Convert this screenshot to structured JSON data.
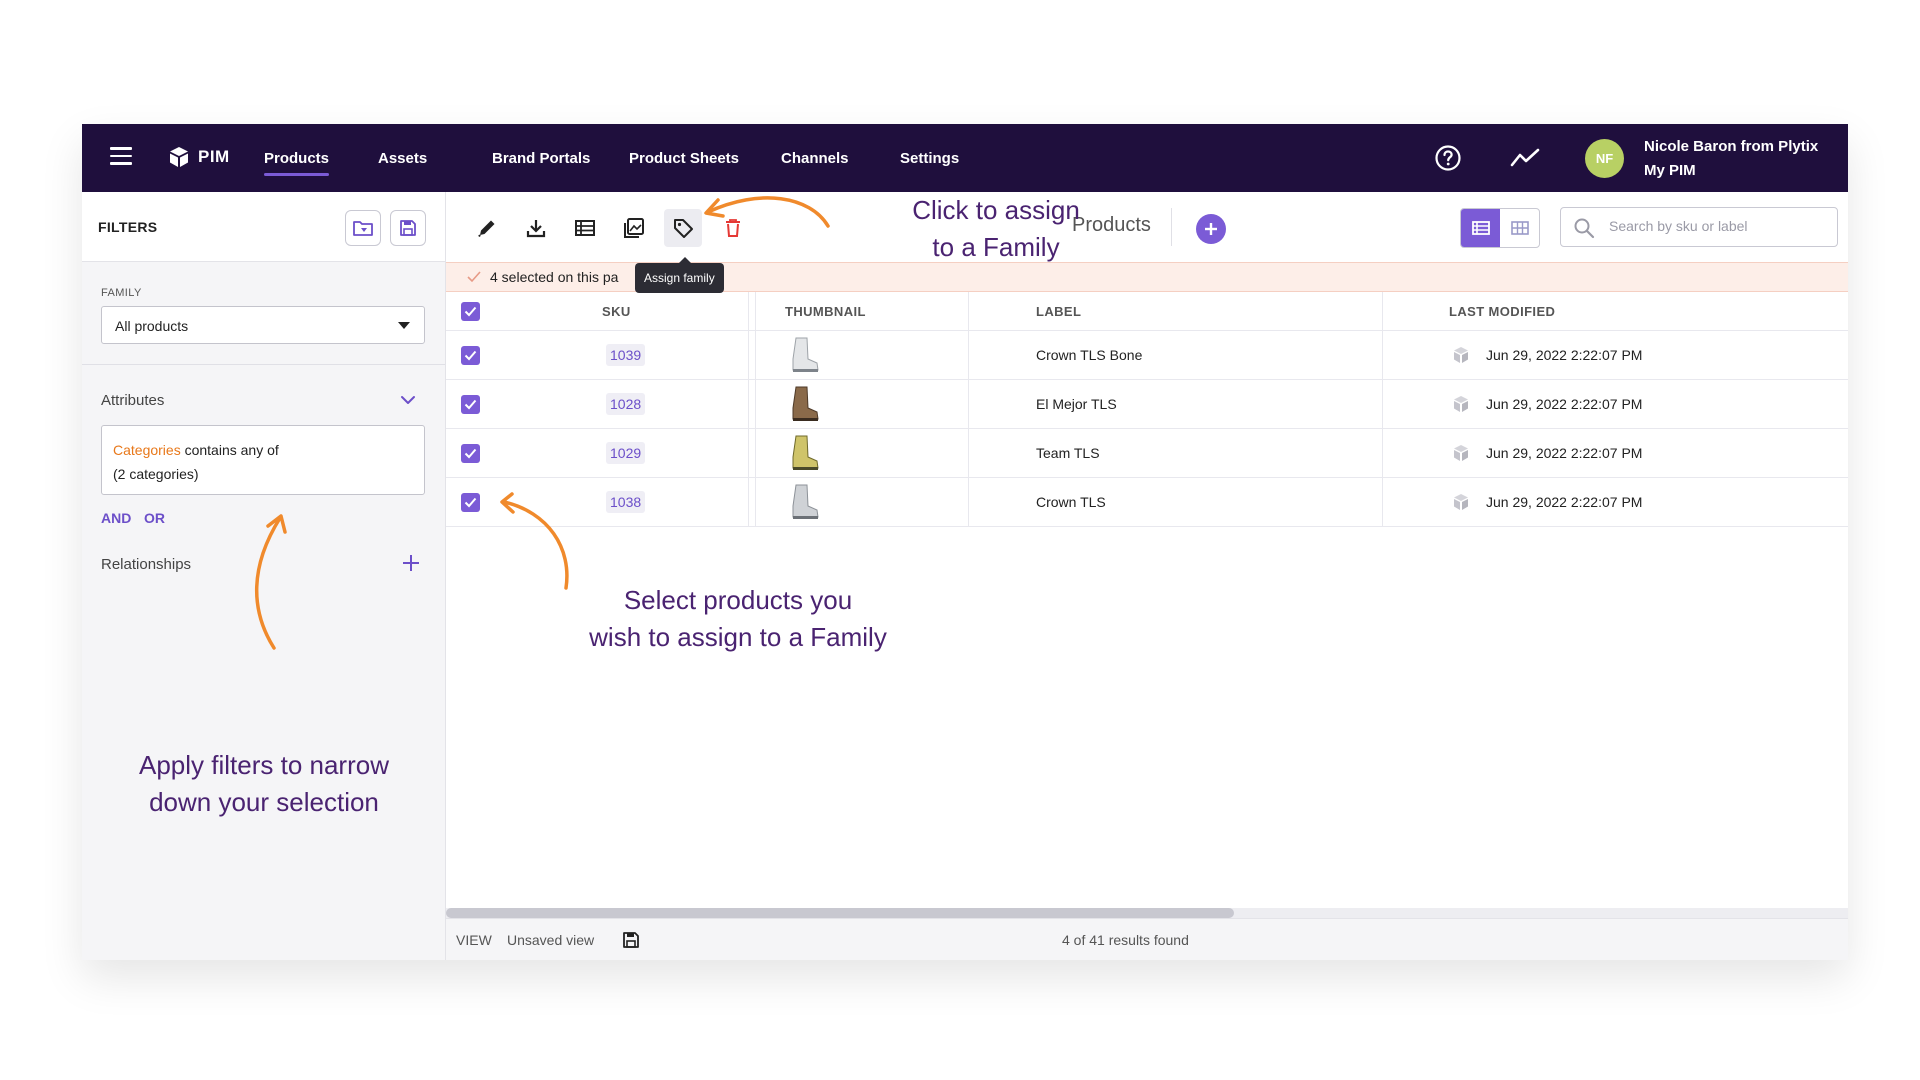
{
  "nav": {
    "brand": "PIM",
    "items": [
      "Products",
      "Assets",
      "Brand Portals",
      "Product Sheets",
      "Channels",
      "Settings"
    ],
    "active": "Products",
    "user_initials": "NF",
    "user_name": "Nicole Baron from Plytix",
    "user_sub": "My PIM",
    "avatar_color": "#b8d064",
    "bar_color": "#1f0f3d",
    "accent": "#7b5bd6"
  },
  "sidebar": {
    "title": "FILTERS",
    "family_label": "FAMILY",
    "family_value": "All products",
    "attributes_label": "Attributes",
    "filter_highlight": "Categories",
    "filter_rest": " contains any of",
    "filter_line2": "(2 categories)",
    "and_label": "AND",
    "or_label": "OR",
    "relationships_label": "Relationships"
  },
  "toolbar": {
    "tooltip": "Assign family",
    "title": "Products",
    "search_placeholder": "Search by sku or label"
  },
  "selection": {
    "text": "4 selected on this pa"
  },
  "table": {
    "columns": [
      "SKU",
      "THUMBNAIL",
      "LABEL",
      "LAST MODIFIED"
    ],
    "rows": [
      {
        "sku": "1039",
        "label": "Crown TLS Bone",
        "modified": "Jun 29, 2022 2:22:07 PM",
        "thumb": "white-boot"
      },
      {
        "sku": "1028",
        "label": "El Mejor TLS",
        "modified": "Jun 29, 2022 2:22:07 PM",
        "thumb": "brown-boot"
      },
      {
        "sku": "1029",
        "label": "Team TLS",
        "modified": "Jun 29, 2022 2:22:07 PM",
        "thumb": "yellow-boot"
      },
      {
        "sku": "1038",
        "label": "Crown TLS",
        "modified": "Jun 29, 2022 2:22:07 PM",
        "thumb": "grey-boot"
      }
    ]
  },
  "footer": {
    "view_label": "VIEW",
    "view_name": "Unsaved view",
    "results": "4 of 41 results found"
  },
  "callouts": {
    "assign_line1": "Click to assign",
    "assign_line2": "to a Family",
    "select_line1": "Select products you",
    "select_line2": "wish to assign to a Family",
    "filters_line1": "Apply filters to narrow",
    "filters_line2": "down your selection",
    "text_color": "#4a2371",
    "arrow_color": "#f08a2c"
  }
}
